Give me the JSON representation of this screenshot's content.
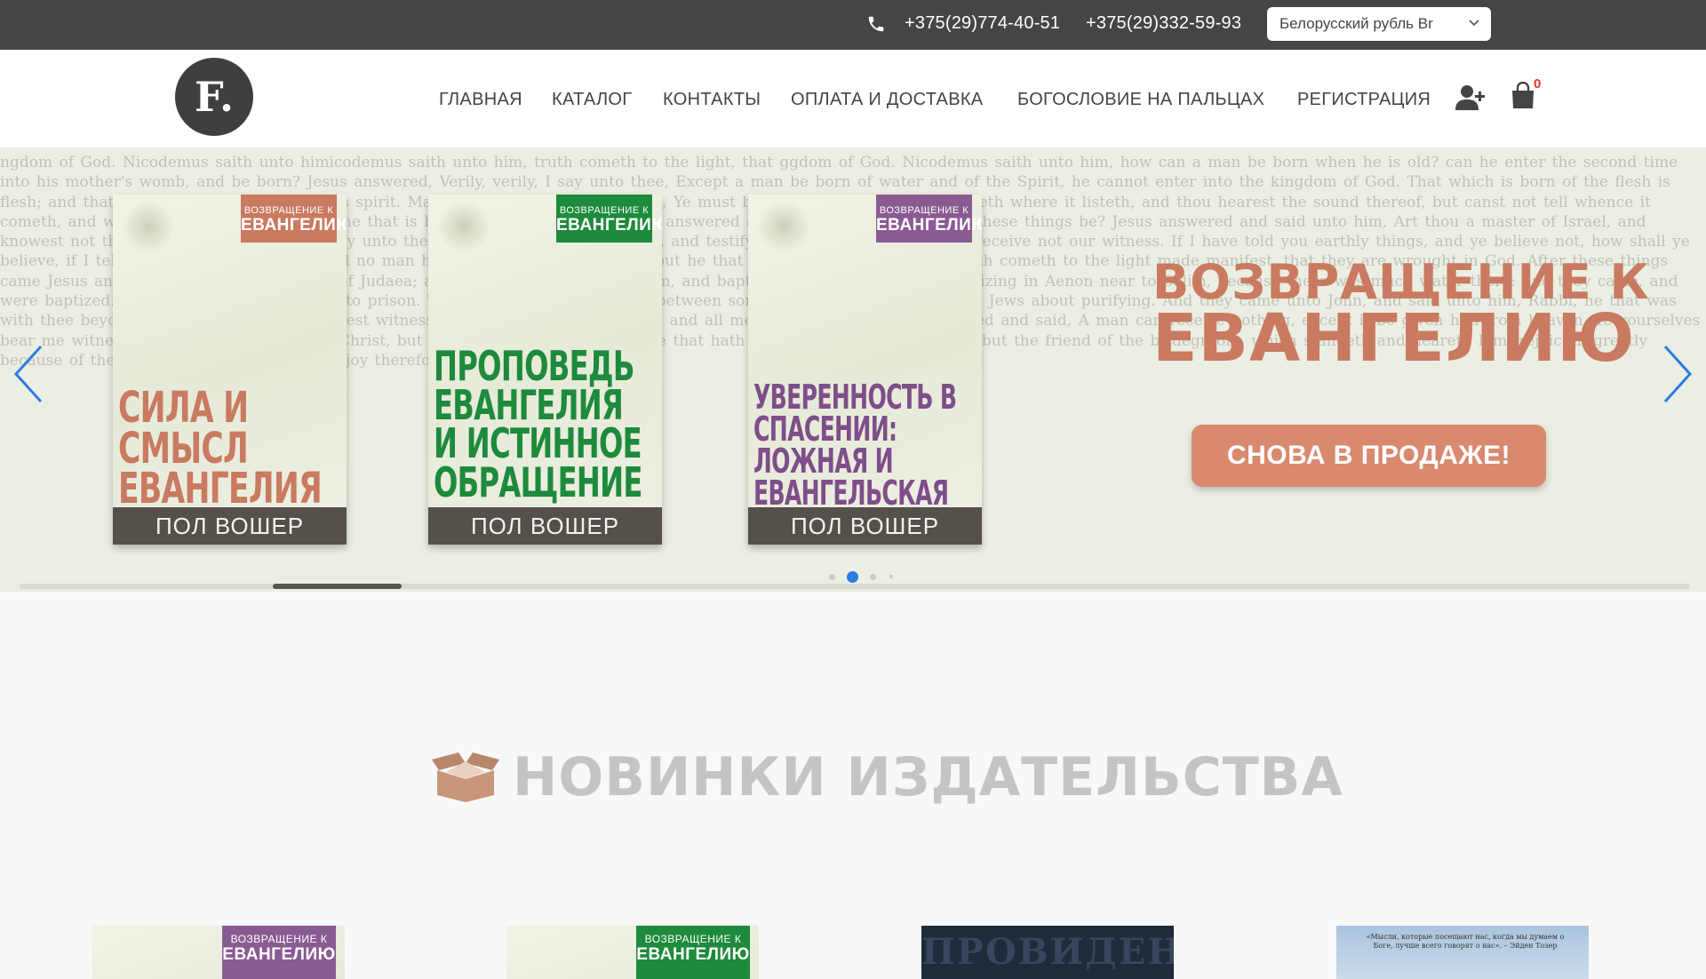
{
  "topbar": {
    "phone1": "+375(29)774-40-51",
    "phone2": "+375(29)332-59-93",
    "currency": "Белорусский рубль Br"
  },
  "header": {
    "logo_text": "F.",
    "nav": [
      "ГЛАВНАЯ",
      "КАТАЛОГ",
      "КОНТАКТЫ",
      "ОПЛАТА И ДОСТАВКА",
      "БОГОСЛОВИЕ НА ПАЛЬЦАХ",
      "РЕГИСТРАЦИЯ"
    ],
    "cart_count": "0",
    "icons": [
      "user-add-icon",
      "shopping-bag-icon"
    ]
  },
  "slider": {
    "books": [
      {
        "badge_top": "ВОЗВРАЩЕНИЕ К",
        "badge_bottom": "ЕВАНГЕЛИЮ",
        "badge_color": "#c97a60",
        "title": "СИЛА И СМЫСЛ ЕВАНГЕЛИЯ",
        "title_color": "#c97a60",
        "author": "ПОЛ ВОШЕР"
      },
      {
        "badge_top": "ВОЗВРАЩЕНИЕ К",
        "badge_bottom": "ЕВАНГЕЛИЮ",
        "badge_color": "#1d8a3c",
        "title": "ПРОПОВЕДЬ ЕВАНГЕЛИЯ И ИСТИННОЕ ОБРАЩЕНИЕ",
        "title_color": "#1d8a3c",
        "author": "ПОЛ ВОШЕР"
      },
      {
        "badge_top": "ВОЗВРАЩЕНИЕ К",
        "badge_bottom": "ЕВАНГЕЛИЮ",
        "badge_color": "#8a5b93",
        "title": "УВЕРЕННОСТЬ В СПАСЕНИИ: ЛОЖНАЯ И ЕВАНГЕЛЬСКАЯ",
        "title_color": "#7e4e8a",
        "author": "ПОЛ ВОШЕР"
      }
    ],
    "promo_line1": "ВОЗВРАЩЕНИЕ К",
    "promo_line2": "ЕВАНГЕЛИЮ",
    "promo_button": "СНОВА В ПРОДАЖЕ!",
    "dots_count": 4,
    "active_dot": 1,
    "background_text": "ngdom of God. Nicodemus saith unto himicodemus saith unto him, truth cometh to the light, that ggdom of God. Nicodemus saith unto him, how can a man be born when he is old? can he enter the second time into his mother's womb, and be born? Jesus answered, Verily, verily, I say unto thee, Except a man be born of water and of the Spirit, he cannot enter into the kingdom of God. That which is born of the flesh is flesh; and that which is born of the Spirit is spirit. Marvel not that I said unto thee, Ye must be born again. The wind bloweth where it listeth, and thou hearest the sound thereof, but canst not tell whence it cometh, and whither it goeth: so is every one that is born of the Spirit. Nicodemus answered and said unto him, How can these things be? Jesus answered and said unto him, Art thou a master of Israel, and knowest not these things? Verily, verily, I say unto thee, We speak that we do know, and testify that we have seen; and ye receive not our witness. If I have told you earthly things, and ye believe not, how shall ye believe, if I tell you of heavenly things? And no man hath ascended up to heaven, but he that came down from heaven. truth cometh to the light made manifest, that they are wrought in God. After these things came Jesus and his disciples into the land of Judaea; and there he tarried with them, and baptized. And John also was baptizing in Aenon near to Salim, because there was much water there: and they came, and were baptized. For John was not yet cast into prison. Then there arose a question between some of John's disciples and the Jews about purifying. And they came unto John, and said unto him, Rabbi, he that was with thee beyond Jordan, to whom thou barest witness, behold, the same baptizeth, and all men come to him. John answered and said, A man can receive nothing, except it be given him from heaven. Ye yourselves bear me witness, that I said, I am not the Christ, but that I am sent before him. He that hath the bride is the bridegroom: but the friend of the bridegroom, which standeth and heareth him, rejoiceth greatly because of the bridegroom's voice: this my joy therefore is fulfilled."
  },
  "section": {
    "title": "НОВИНКИ ИЗДАТЕЛЬСТВА",
    "icon": "open-box-icon"
  },
  "covers": [
    {
      "badge_top": "ВОЗВРАЩЕНИЕ К",
      "badge_bottom": "ЕВАНГЕЛИЮ",
      "badge_color": "#8a5b93"
    },
    {
      "badge_top": "ВОЗВРАЩЕНИЕ К",
      "badge_bottom": "ЕВАНГЕЛИЮ",
      "badge_color": "#1d8a3c"
    },
    {
      "title": "ПРОВИДЕНИЕ"
    },
    {
      "quote": "«Мысли, которые посещают нас, когда мы думаем о Боге, лучше всего говорят о нас». – Эйден Тозер"
    }
  ],
  "colors": {
    "topbar_bg": "#454545",
    "promo": "#c97a60",
    "button": "#d9896e",
    "active_dot": "#2c7be5",
    "arrow": "#2c7be5"
  }
}
